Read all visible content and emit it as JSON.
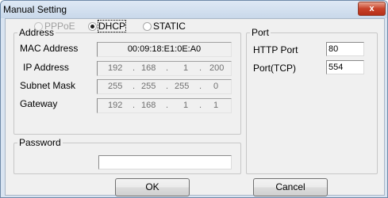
{
  "window": {
    "title": "Manual Setting",
    "close_glyph": "x"
  },
  "address": {
    "legend": "Address",
    "modes": [
      {
        "label": "PPPoE",
        "selected": false,
        "enabled": false
      },
      {
        "label": "DHCP",
        "selected": true,
        "enabled": true
      },
      {
        "label": "STATIC",
        "selected": false,
        "enabled": true
      }
    ],
    "mac_label": "MAC Address",
    "mac_value": "00:09:18:E1:0E:A0",
    "ip_label": "IP Address",
    "ip": [
      "192",
      "168",
      "1",
      "200"
    ],
    "subnet_label": "Subnet Mask",
    "subnet": [
      "255",
      "255",
      "255",
      "0"
    ],
    "gateway_label": "Gateway",
    "gateway": [
      "192",
      "168",
      "1",
      "1"
    ]
  },
  "password": {
    "legend": "Password",
    "value": ""
  },
  "port": {
    "legend": "Port",
    "http_label": "HTTP Port",
    "http_value": "80",
    "tcp_label": "Port(TCP)",
    "tcp_value": "554"
  },
  "buttons": {
    "ok": "OK",
    "cancel": "Cancel"
  },
  "colors": {
    "title_bar": "#c9d8ea",
    "close_button": "#c8422a",
    "dialog_bg": "#f0f0f0"
  }
}
